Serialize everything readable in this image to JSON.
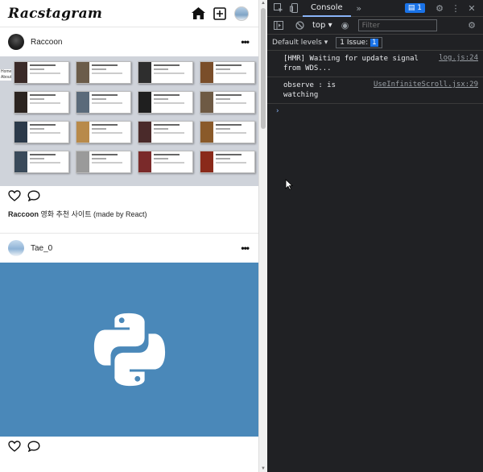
{
  "app": {
    "logo": "Racstagram",
    "header_icons": [
      "home-icon",
      "add-post-icon",
      "profile-avatar"
    ]
  },
  "posts": [
    {
      "username": "Raccoon",
      "caption_user": "Raccoon",
      "caption_text": " 영화 추천 사이트 (made by React)",
      "image": "movie-site-screenshot",
      "mini_nav": [
        "Home",
        "About"
      ]
    },
    {
      "username": "Tae_0",
      "image": "python-logo"
    }
  ],
  "devtools": {
    "tab": "Console",
    "issue_badge": "1",
    "context": "top",
    "filter_placeholder": "Filter",
    "levels": "Default levels",
    "issues_label": "1 Issue:",
    "issues_count": "1",
    "logs": [
      {
        "message": "[HMR] Waiting for update signal\nfrom WDS...",
        "source": "log.js:24"
      },
      {
        "message": "observe : is\nwatching",
        "source": "UseInfiniteScroll.jsx:29"
      }
    ],
    "prompt": "›"
  },
  "colors": {
    "devtools_bg": "#202124",
    "accent": "#1a73e8",
    "python_bg": "#4a88b9"
  }
}
